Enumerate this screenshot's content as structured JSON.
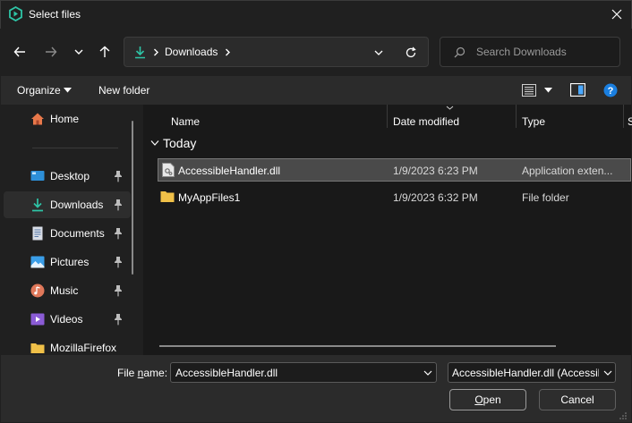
{
  "window": {
    "title": "Select files"
  },
  "address": {
    "crumb": "Downloads"
  },
  "search": {
    "placeholder": "Search Downloads"
  },
  "toolbar": {
    "organize": "Organize",
    "new_folder": "New folder"
  },
  "sidebar": {
    "home": "Home",
    "items": [
      {
        "label": "Desktop",
        "icon": "desktop-icon"
      },
      {
        "label": "Downloads",
        "icon": "download-icon"
      },
      {
        "label": "Documents",
        "icon": "document-icon"
      },
      {
        "label": "Pictures",
        "icon": "picture-icon"
      },
      {
        "label": "Music",
        "icon": "music-icon"
      },
      {
        "label": "Videos",
        "icon": "video-icon"
      },
      {
        "label": "MozillaFirefox",
        "icon": "folder-icon"
      }
    ]
  },
  "columns": {
    "name": "Name",
    "date": "Date modified",
    "type": "Type",
    "size": "S"
  },
  "group": {
    "label": "Today"
  },
  "files": [
    {
      "name": "AccessibleHandler.dll",
      "date": "1/9/2023 6:23 PM",
      "type": "Application exten...",
      "icon": "dll-file-icon"
    },
    {
      "name": "MyAppFiles1",
      "date": "1/9/2023 6:32 PM",
      "type": "File folder",
      "icon": "folder-icon"
    }
  ],
  "footer": {
    "filename_label_pre": "File ",
    "filename_label_u": "n",
    "filename_label_post": "ame:",
    "filename_value": "AccessibleHandler.dll",
    "filter_value": "AccessibleHandler.dll (AccessibleHa",
    "open_pre": "",
    "open_u": "O",
    "open_post": "pen",
    "cancel": "Cancel"
  },
  "colors": {
    "accent": "#0078d4",
    "folder": "#f0c048",
    "selected_row": "#4a4a4a"
  }
}
